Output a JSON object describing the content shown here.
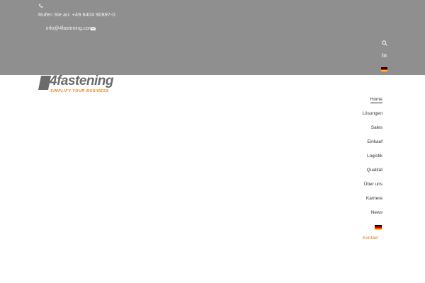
{
  "topbar": {
    "phone_text": "Rufen Sie an: +49 6404 90897-0",
    "email_text": "info@4fastening.com",
    "icons": [
      "phone-icon",
      "mail-icon",
      "search-icon",
      "linkedin-icon",
      "flag-de-icon"
    ],
    "linkedin_label": "in"
  },
  "logo": {
    "word": "4fastening",
    "tagline": "SIMPLIFY YOUR BUSINESS"
  },
  "nav": {
    "items": [
      "Home",
      "Lösungen",
      "Sales",
      "Einkauf",
      "Logistik",
      "Qualität",
      "Über uns",
      "Karriere",
      "News"
    ],
    "contact": "Kontakt",
    "active": "Home"
  },
  "colors": {
    "topbar_bg": "#8f8f8f",
    "accent": "#e07b1f",
    "logo_gray": "#6b6b6b"
  }
}
